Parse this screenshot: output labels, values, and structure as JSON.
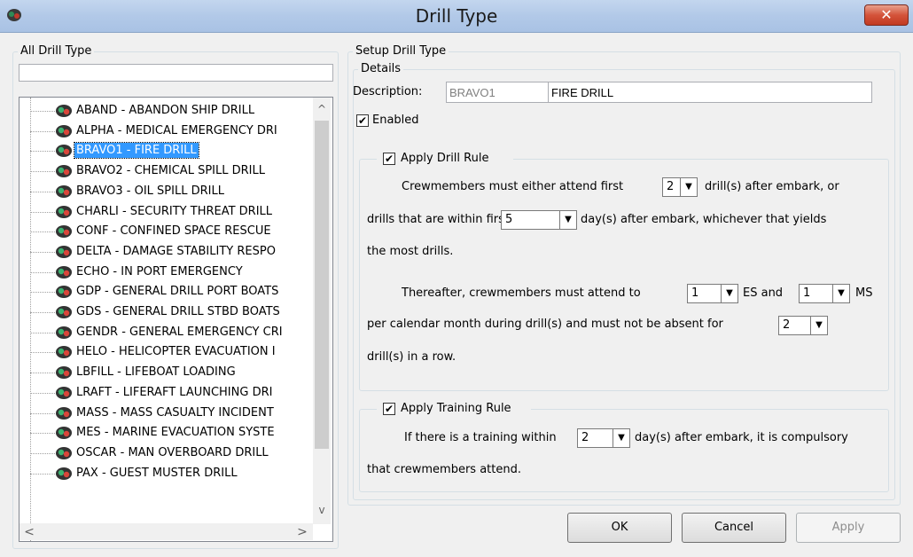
{
  "window": {
    "title": "Drill Type",
    "close_label": "✕"
  },
  "left_panel": {
    "group_label": "All Drill Type",
    "search_value": "",
    "items": [
      {
        "label": "ABAND - ABANDON SHIP DRILL"
      },
      {
        "label": "ALPHA - MEDICAL EMERGENCY DRI"
      },
      {
        "label": "BRAVO1 - FIRE DRILL"
      },
      {
        "label": "BRAVO2 - CHEMICAL SPILL DRILL"
      },
      {
        "label": "BRAVO3 - OIL SPILL DRILL"
      },
      {
        "label": "CHARLI - SECURITY THREAT DRILL"
      },
      {
        "label": "CONF - CONFINED SPACE RESCUE"
      },
      {
        "label": "DELTA - DAMAGE STABILITY RESPO"
      },
      {
        "label": "ECHO - IN PORT EMERGENCY"
      },
      {
        "label": "GDP - GENERAL DRILL PORT BOATS"
      },
      {
        "label": "GDS - GENERAL DRILL STBD BOATS"
      },
      {
        "label": "GENDR - GENERAL EMERGENCY CRI"
      },
      {
        "label": "HELO - HELICOPTER EVACUATION I"
      },
      {
        "label": "LBFILL - LIFEBOAT LOADING"
      },
      {
        "label": "LRAFT - LIFERAFT LAUNCHING DRI"
      },
      {
        "label": "MASS - MASS CASUALTY INCIDENT"
      },
      {
        "label": "MES - MARINE EVACUATION SYSTE"
      },
      {
        "label": "OSCAR - MAN OVERBOARD DRILL"
      },
      {
        "label": "PAX - GUEST MUSTER DRILL"
      }
    ],
    "selected_index": 2
  },
  "setup": {
    "group_label": "Setup Drill Type",
    "details_label": "Details",
    "description_label": "Description:",
    "code_value": "BRAVO1",
    "name_value": "FIRE DRILL",
    "enabled_label": "Enabled",
    "enabled_checked": true
  },
  "drill_rule": {
    "label": "Apply Drill Rule",
    "checked": true,
    "line1_a": "Crewmembers must either attend first",
    "first_count": "2",
    "line1_b": "drill(s) after embark, or",
    "line2_a": "drills that are within first",
    "days_value": "5",
    "line2_b": "day(s) after embark, whichever that yields",
    "line3": "the most drills.",
    "line4_a": "Thereafter, crewmembers must attend to",
    "es_value": "1",
    "es_label": "ES and",
    "ms_value": "1",
    "ms_label": "MS",
    "line5": "per calendar month during drill(s) and must not be absent for",
    "absent_value": "2",
    "line6": "drill(s) in a row."
  },
  "training_rule": {
    "label": "Apply Training Rule",
    "checked": true,
    "line1_a": "If there is a training within",
    "days_value": "2",
    "line1_b": "day(s) after embark, it is compulsory",
    "line2": "that crewmembers attend."
  },
  "buttons": {
    "ok": "OK",
    "cancel": "Cancel",
    "apply": "Apply"
  },
  "scroll": {
    "up": "^",
    "down": "v",
    "left": "<",
    "right": ">"
  }
}
